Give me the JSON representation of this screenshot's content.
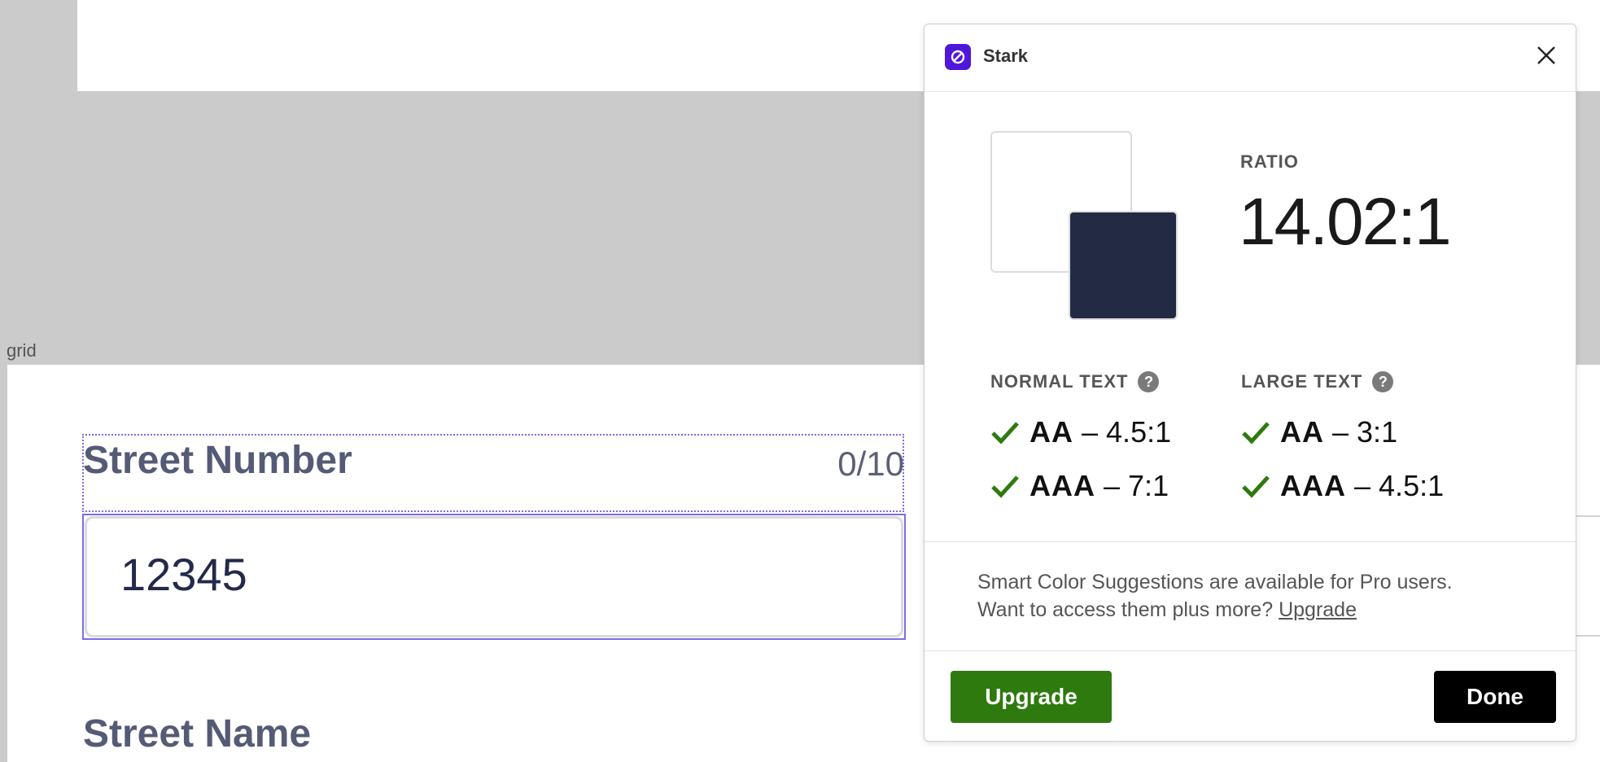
{
  "canvas": {
    "grid_label": "grid",
    "field1": {
      "label": "Street Number",
      "count": "0/10",
      "value": "12345"
    },
    "field2": {
      "label": "Street Name"
    }
  },
  "panel": {
    "title": "Stark",
    "colors": {
      "background": "#ffffff",
      "foreground": "#222a44",
      "logo": "#4f17d9",
      "pass": "#2e7a0e"
    },
    "ratio": {
      "label": "RATIO",
      "value": "14.02:1"
    },
    "normal_text": {
      "heading": "NORMAL TEXT",
      "checks": [
        {
          "level": "AA",
          "ratio": "– 4.5:1",
          "passed": true
        },
        {
          "level": "AAA",
          "ratio": "– 7:1",
          "passed": true
        }
      ]
    },
    "large_text": {
      "heading": "LARGE TEXT",
      "checks": [
        {
          "level": "AA",
          "ratio": "– 3:1",
          "passed": true
        },
        {
          "level": "AAA",
          "ratio": "– 4.5:1",
          "passed": true
        }
      ]
    },
    "promo": {
      "line1": "Smart Color Suggestions are available for Pro users.",
      "line2": "Want to access them plus more?",
      "link": "Upgrade"
    },
    "buttons": {
      "upgrade": "Upgrade",
      "done": "Done"
    }
  }
}
